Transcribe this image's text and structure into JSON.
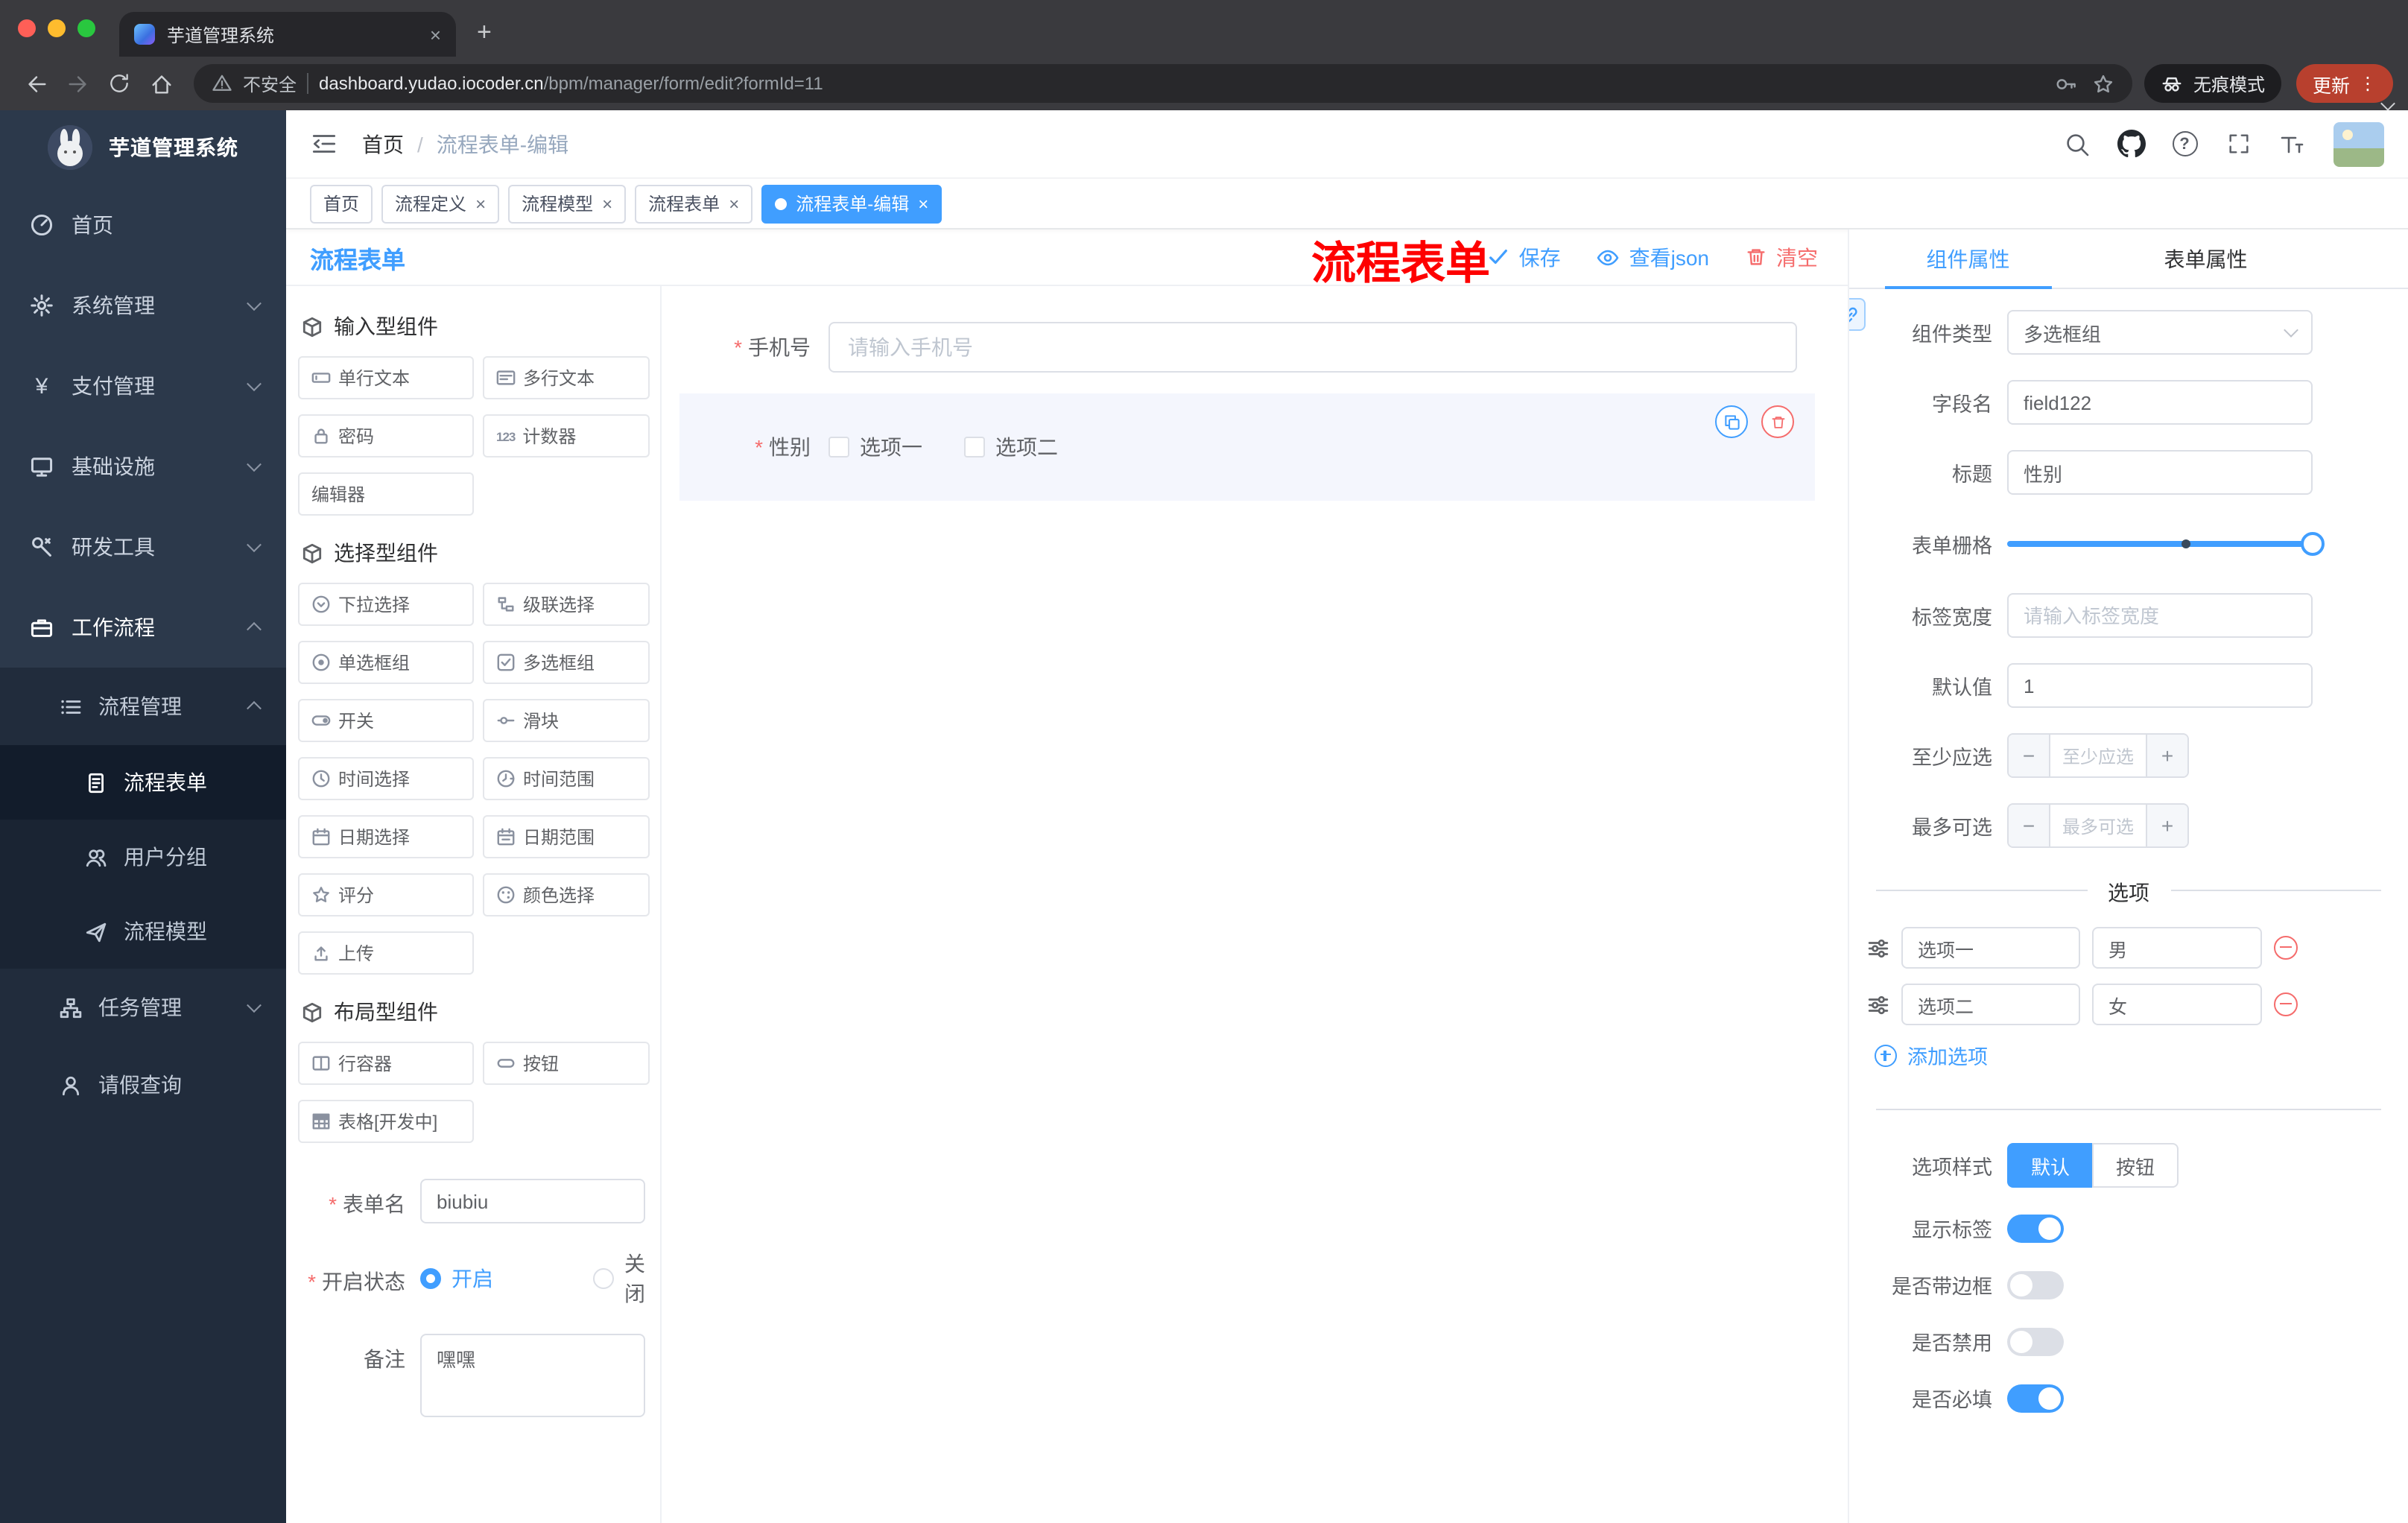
{
  "colors": {
    "accent": "#409eff",
    "danger": "#f56c6c",
    "annotation": "#fe0000",
    "sidebar_dark": "#212c3c",
    "active_tag": "#409eff"
  },
  "browser": {
    "tab": {
      "title": "芋道管理系统"
    },
    "address": {
      "security": "不安全",
      "host": "dashboard.yudao.iocoder.cn",
      "path": "/bpm/manager/form/edit?formId=11"
    },
    "incognito_label": "无痕模式",
    "update_label": "更新"
  },
  "annotation": {
    "text": "流程表单"
  },
  "sidebar": {
    "logo_title": "芋道管理系统",
    "menu": [
      {
        "label": "首页",
        "icon": "dashboard-icon"
      },
      {
        "label": "系统管理",
        "icon": "gear-icon"
      },
      {
        "label": "支付管理",
        "icon": "yen-icon"
      },
      {
        "label": "基础设施",
        "icon": "monitor-icon"
      },
      {
        "label": "研发工具",
        "icon": "tools-icon"
      },
      {
        "label": "工作流程",
        "icon": "briefcase-icon"
      }
    ],
    "process_menu": {
      "label": "流程管理",
      "icon": "list-icon"
    },
    "process_children": [
      {
        "label": "流程表单",
        "icon": "document-icon",
        "active": true
      },
      {
        "label": "用户分组",
        "icon": "users-icon"
      },
      {
        "label": "流程模型",
        "icon": "send-icon"
      }
    ],
    "task_menu": {
      "label": "任务管理",
      "icon": "tree-icon"
    },
    "leave_item": {
      "label": "请假查询",
      "icon": "user-icon"
    }
  },
  "header": {
    "breadcrumb_home": "首页",
    "breadcrumb_current": "流程表单-编辑"
  },
  "tags": [
    {
      "label": "首页",
      "closable": false,
      "active": false
    },
    {
      "label": "流程定义",
      "closable": true,
      "active": false
    },
    {
      "label": "流程模型",
      "closable": true,
      "active": false
    },
    {
      "label": "流程表单",
      "closable": true,
      "active": false
    },
    {
      "label": "流程表单-编辑",
      "closable": true,
      "active": true
    }
  ],
  "designer": {
    "title": "流程表单",
    "toolbar": {
      "save": "保存",
      "view_json": "查看json",
      "clear": "清空"
    },
    "palette": {
      "groups": [
        {
          "title": "输入型组件",
          "items": [
            {
              "label": "单行文本",
              "icon": "input-icon"
            },
            {
              "label": "多行文本",
              "icon": "textarea-icon"
            },
            {
              "label": "密码",
              "icon": "lock-icon"
            },
            {
              "label": "计数器",
              "icon": "counter-icon",
              "icon_text": "123"
            },
            {
              "label": "编辑器",
              "icon": "none"
            }
          ]
        },
        {
          "title": "选择型组件",
          "items": [
            {
              "label": "下拉选择",
              "icon": "select-icon"
            },
            {
              "label": "级联选择",
              "icon": "cascader-icon"
            },
            {
              "label": "单选框组",
              "icon": "radio-icon"
            },
            {
              "label": "多选框组",
              "icon": "checkbox-icon"
            },
            {
              "label": "开关",
              "icon": "switch-icon"
            },
            {
              "label": "滑块",
              "icon": "slider-icon"
            },
            {
              "label": "时间选择",
              "icon": "clock-icon"
            },
            {
              "label": "时间范围",
              "icon": "clock-range-icon"
            },
            {
              "label": "日期选择",
              "icon": "calendar-icon"
            },
            {
              "label": "日期范围",
              "icon": "calendar-range-icon"
            },
            {
              "label": "评分",
              "icon": "star-icon"
            },
            {
              "label": "颜色选择",
              "icon": "color-icon"
            },
            {
              "label": "上传",
              "icon": "upload-icon"
            }
          ]
        },
        {
          "title": "布局型组件",
          "items": [
            {
              "label": "行容器",
              "icon": "row-container-icon"
            },
            {
              "label": "按钮",
              "icon": "button-icon"
            },
            {
              "label": "表格[开发中]",
              "icon": "table-icon"
            }
          ]
        }
      ]
    },
    "meta": {
      "name_label": "表单名",
      "name_value": "biubiu",
      "status_label": "开启状态",
      "status_on": "开启",
      "status_off": "关闭",
      "status_selected": "开启",
      "remark_label": "备注",
      "remark_value": "嘿嘿"
    },
    "canvas": {
      "phone_label": "手机号",
      "phone_placeholder": "请输入手机号",
      "gender_label": "性别",
      "gender_options": [
        "选项一",
        "选项二"
      ]
    }
  },
  "props": {
    "tab_component": "组件属性",
    "tab_form": "表单属性",
    "active_tab": "组件属性",
    "rows": {
      "type_label": "组件类型",
      "type_value": "多选框组",
      "field_label": "字段名",
      "field_value": "field122",
      "title_label": "标题",
      "title_value": "性别",
      "grid_label": "表单栅格",
      "width_label": "标签宽度",
      "width_placeholder": "请输入标签宽度",
      "default_label": "默认值",
      "default_value": "1",
      "min_label": "至少应选",
      "min_placeholder": "至少应选",
      "max_label": "最多可选",
      "max_placeholder": "最多可选"
    },
    "options": {
      "divider": "选项",
      "rows": [
        {
          "name": "选项一",
          "value": "男"
        },
        {
          "name": "选项二",
          "value": "女"
        }
      ],
      "add": "添加选项"
    },
    "style": {
      "label": "选项样式",
      "default": "默认",
      "button": "按钮",
      "selected": "默认"
    },
    "switches": [
      {
        "label": "显示标签",
        "on": true
      },
      {
        "label": "是否带边框",
        "on": false
      },
      {
        "label": "是否禁用",
        "on": false
      },
      {
        "label": "是否必填",
        "on": true
      }
    ]
  }
}
